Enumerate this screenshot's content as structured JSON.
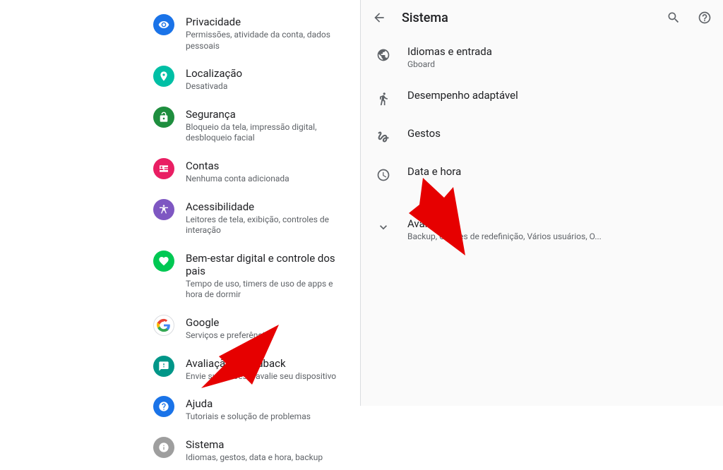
{
  "left": {
    "items": [
      {
        "title": "Privacidade",
        "sub": "Permissões, atividade da conta, dados pessoais"
      },
      {
        "title": "Localização",
        "sub": "Desativada"
      },
      {
        "title": "Segurança",
        "sub": "Bloqueio da tela, impressão digital, desbloqueio facial"
      },
      {
        "title": "Contas",
        "sub": "Nenhuma conta adicionada"
      },
      {
        "title": "Acessibilidade",
        "sub": "Leitores de tela, exibição, controles de interação"
      },
      {
        "title": "Bem-estar digital e controle dos pais",
        "sub": "Tempo de uso, timers de uso de apps e hora de dormir"
      },
      {
        "title": "Google",
        "sub": "Serviços e preferências"
      },
      {
        "title": "Avaliação e feedback",
        "sub": "Envie sugestões e avalie seu dispositivo"
      },
      {
        "title": "Ajuda",
        "sub": "Tutoriais e solução de problemas"
      },
      {
        "title": "Sistema",
        "sub": "Idiomas, gestos, data e hora, backup"
      }
    ]
  },
  "right": {
    "header": "Sistema",
    "items": [
      {
        "title": "Idiomas e entrada",
        "sub": "Gboard"
      },
      {
        "title": "Desempenho adaptável",
        "sub": ""
      },
      {
        "title": "Gestos",
        "sub": ""
      },
      {
        "title": "Data e hora",
        "sub": ""
      },
      {
        "title": "Avançado",
        "sub": "Backup, Opções de redefinição, Vários usuários, O..."
      }
    ]
  }
}
